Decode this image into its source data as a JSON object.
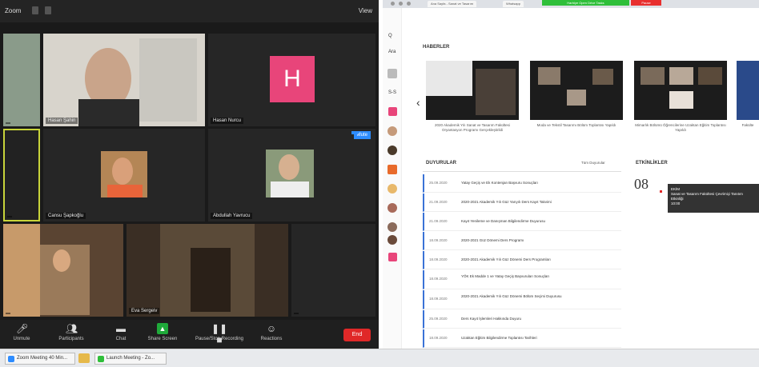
{
  "zoom": {
    "title": "Zoom",
    "view_label": "View",
    "participants": [
      {
        "name": ""
      },
      {
        "name": "Hasan Şahin"
      },
      {
        "name": "Hasan Nurcu",
        "initial": "H"
      },
      {
        "name": ""
      },
      {
        "name": "Cansu Şapkoğlu"
      },
      {
        "name": "Abdullah Yavrucu"
      },
      {
        "name": ""
      },
      {
        "name": "Eva Sergeiv"
      },
      {
        "name": ""
      }
    ],
    "tile_badges": [
      "Mute",
      ""
    ],
    "toolbar": {
      "unmute": "Unmute",
      "participants": "Participants",
      "chat": "Chat",
      "share": "Share Screen",
      "pause": "Pause/Stop Recording",
      "reactions": "Reactions",
      "end": "End"
    }
  },
  "taskbar": {
    "items": [
      "Zoom Meeting 40 Min...",
      "Launch Meeting - Zo..."
    ]
  },
  "browser": {
    "tabs": [
      "Ana Sayfa - Sanat ve Tasarım",
      "Whatsapp"
    ],
    "green_tab": "Harbiye Open Drive Tasks",
    "red_tab": "Pause",
    "sidebar_texts": [
      "Q",
      "Ara",
      "S-S"
    ],
    "sections": {
      "news": "HABERLER",
      "announcements": "DUYURULAR",
      "events": "ETKİNLİKLER"
    },
    "more_link": "Tüm Duyurular",
    "news": [
      {
        "caption": "2020 Akademik Yılı Sanat ve Tasarım Fakültesi Oryantasyon Programı Gerçekleştirildi"
      },
      {
        "caption": "Moda ve Tekstil Tasarımı Bölüm Toplantısı Yapıldı"
      },
      {
        "caption": "Mimarlık Bölümü Öğrencilerine Uzaktan Eğitim Toplantısı Yapıldı"
      },
      {
        "caption": "Fakülte"
      }
    ],
    "announcements": [
      {
        "date": "25.09.2020",
        "text": "Yatay Geçiş ve Ek Kontenjan Başvuru Sonuçları"
      },
      {
        "date": "21.09.2020",
        "text": "2020-2021 Akademik Yılı Güz Yarıyılı Ders Kayıt Takvimi"
      },
      {
        "date": "21.09.2020",
        "text": "Kayıt Yenileme ve Danışman Bilgilendirme Duyurusu"
      },
      {
        "date": "18.09.2020",
        "text": "2020-2021 Güz Dönemi Ders Programı"
      },
      {
        "date": "18.09.2020",
        "text": "2020-2021 Akademik Yılı Güz Dönemi Ders Programları"
      },
      {
        "date": "18.09.2020",
        "text": "YÖK Ek Madde 1 ve Yatay Geçiş Başvuruları Sonuçları",
        "tall": true
      },
      {
        "date": "18.09.2020",
        "text": "2020-2021 Akademik Yılı Güz Dönemi Bölüm Seçimi Duyurusu",
        "tall": true
      },
      {
        "date": "25.09.2020",
        "text": "Ders Kayıt İşlemleri Hakkında Duyuru"
      },
      {
        "date": "18.09.2020",
        "text": "Uzaktan Eğitim Bilgilendirme Toplantısı Tarihleri"
      }
    ],
    "event": {
      "day": "08",
      "month": "EKİM",
      "title": "Sanat ve Tasarım Fakültesi Çevrimiçi Tanıtım Etkinliği",
      "time": "10:00"
    }
  },
  "colors": {
    "zoom_bg": "#1a1a1a",
    "avatar_pink": "#e8457a",
    "share_green": "#1faa3a",
    "end_red": "#e02828",
    "accent_blue": "#3a72d6"
  }
}
